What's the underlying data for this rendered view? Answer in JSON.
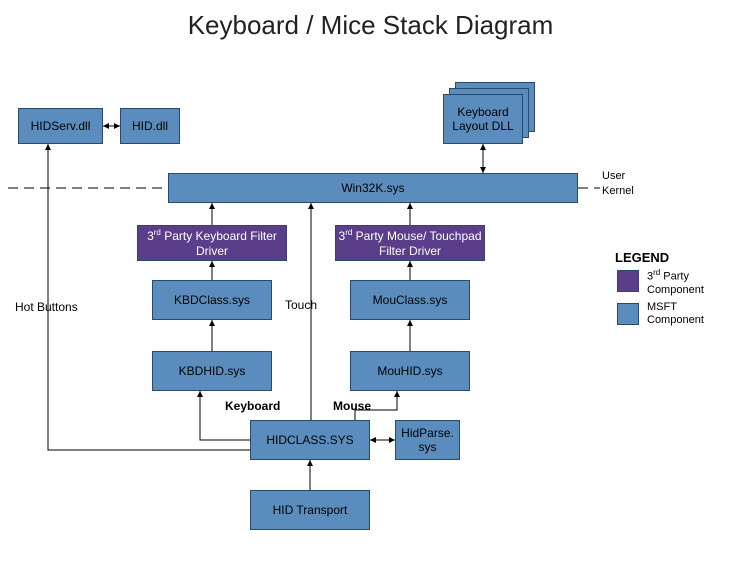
{
  "title": "Keyboard / Mice Stack Diagram",
  "boxes": {
    "hidserv": "HIDServ.dll",
    "hiddll": "HID.dll",
    "kbdlayout": "Keyboard Layout DLL",
    "win32k": "Win32K.sys",
    "kbdfilter": "3<sup>rd</sup> Party Keyboard Filter Driver",
    "mousefilter": "3<sup>rd</sup> Party Mouse/ Touchpad Filter Driver",
    "kbdclass": "KBDClass.sys",
    "mouclass": "MouClass.sys",
    "kbdhid": "KBDHID.sys",
    "mouhid": "MouHID.sys",
    "hidclass": "HIDCLASS.SYS",
    "hidparse": "HidParse. sys",
    "hidtransport": "HID Transport"
  },
  "labels": {
    "hotbuttons": "Hot Buttons",
    "touch": "Touch",
    "keyboard": "Keyboard",
    "mouse": "Mouse",
    "user": "User",
    "kernel": "Kernel"
  },
  "legend": {
    "title": "LEGEND",
    "third": "3<sup>rd</sup> Party Component",
    "msft": "MSFT Component"
  },
  "colors": {
    "msft": "#5a8dbd",
    "third": "#5a3e8a",
    "border": "#2a4a6a"
  }
}
